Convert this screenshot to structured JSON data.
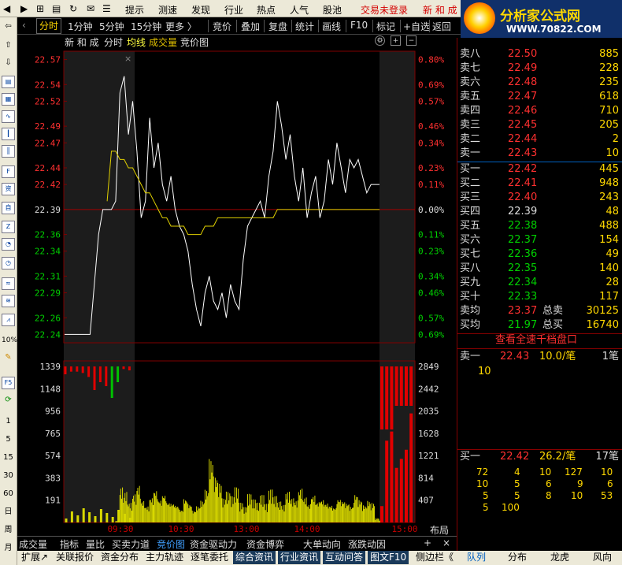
{
  "menu": {
    "items": [
      "提示",
      "测速",
      "发现",
      "行业",
      "热点",
      "人气",
      "股池"
    ],
    "status": "交易未登录",
    "stock": "新 和 成"
  },
  "logo": {
    "title": "分析家公式网",
    "url": "WWW.70822.COM"
  },
  "tabs": {
    "left": [
      "分时",
      "1分钟",
      "5分钟",
      "15分钟",
      "更多 〉"
    ],
    "right": [
      "竞价",
      "叠加",
      "复盘",
      "统计",
      "画线",
      "F10",
      "标记",
      "+自选",
      "返回"
    ]
  },
  "chart_header": {
    "name": "新 和 成",
    "mode": "分时",
    "avg": "均线",
    "vol": "成交量",
    "bid": "竞价图"
  },
  "leftbar": [
    "1",
    "5",
    "15",
    "30",
    "60",
    "日",
    "周",
    "月"
  ],
  "chart_data": {
    "type": "line",
    "title": "新和成 分时",
    "prev_close": 22.39,
    "price_ticks": [
      "22.57",
      "22.54",
      "22.52",
      "22.49",
      "22.47",
      "22.44",
      "22.42",
      "22.39",
      "22.36",
      "22.34",
      "22.31",
      "22.29",
      "22.26",
      "22.24"
    ],
    "pct_ticks": [
      "0.80%",
      "0.69%",
      "0.57%",
      "0.46%",
      "0.34%",
      "0.23%",
      "0.11%",
      "0.00%",
      "0.11%",
      "0.23%",
      "0.34%",
      "0.46%",
      "0.57%",
      "0.69%"
    ],
    "vol_ticks": [
      "1339",
      "1148",
      "956",
      "765",
      "574",
      "383",
      "191"
    ],
    "vol_right_ticks": [
      "2849",
      "2442",
      "2035",
      "1628",
      "1221",
      "814",
      "407"
    ],
    "time_ticks": [
      "09:30",
      "10:30",
      "13:00",
      "14:00",
      "15:00"
    ],
    "price": [
      22.24,
      22.24,
      22.24,
      22.24,
      22.24,
      22.24,
      22.24,
      22.3,
      22.36,
      22.39,
      22.39,
      22.39,
      22.4,
      22.53,
      22.55,
      22.48,
      22.52,
      22.46,
      22.38,
      22.4,
      22.5,
      22.44,
      22.47,
      22.42,
      22.4,
      22.43,
      22.39,
      22.37,
      22.36,
      22.34,
      22.3,
      22.27,
      22.25,
      22.29,
      22.31,
      22.28,
      22.27,
      22.29,
      22.26,
      22.3,
      22.28,
      22.27,
      22.33,
      22.37,
      22.38,
      22.39,
      22.4,
      22.38,
      22.43,
      22.46,
      22.52,
      22.49,
      22.45,
      22.48,
      22.43,
      22.4,
      22.44,
      22.38,
      22.41,
      22.43,
      22.38,
      22.4,
      22.45,
      22.42,
      22.47,
      22.44,
      22.41,
      22.45,
      22.44,
      22.45,
      22.43,
      22.41,
      22.42,
      22.42,
      22.42
    ],
    "avg": [
      22.39,
      22.39,
      22.39,
      22.39,
      22.39,
      22.39,
      22.39,
      22.39,
      22.39,
      22.39,
      22.4,
      22.46,
      22.46,
      22.45,
      22.45,
      22.44,
      22.44,
      22.43,
      22.42,
      22.41,
      22.41,
      22.4,
      22.39,
      22.38,
      22.38,
      22.37,
      22.37,
      22.37,
      22.37,
      22.36,
      22.36,
      22.36,
      22.36,
      22.37,
      22.37,
      22.37,
      22.38,
      22.38,
      22.38,
      22.38,
      22.38,
      22.38,
      22.38,
      22.38,
      22.38,
      22.38,
      22.38,
      22.38,
      22.38,
      22.38,
      22.39,
      22.39,
      22.39,
      22.39,
      22.39,
      22.39,
      22.39,
      22.39,
      22.39,
      22.39,
      22.39,
      22.39,
      22.39,
      22.39,
      22.39,
      22.39,
      22.39,
      22.39,
      22.39,
      22.39,
      22.39,
      22.39,
      22.39,
      22.39,
      22.39
    ],
    "volume": [
      0,
      0,
      0,
      0,
      0,
      0,
      0,
      0,
      0,
      0,
      0,
      0,
      15,
      320,
      280,
      180,
      260,
      340,
      200,
      150,
      230,
      300,
      210,
      260,
      190,
      180,
      160,
      120,
      220,
      170,
      110,
      150,
      200,
      300,
      580,
      420,
      360,
      220,
      280,
      240,
      320,
      180,
      140,
      260,
      210,
      180,
      250,
      170,
      300,
      240,
      190,
      160,
      280,
      220,
      200,
      310,
      230,
      170,
      250,
      190,
      210,
      180,
      160,
      140,
      220,
      200,
      180,
      150,
      260,
      210,
      160,
      200,
      180,
      40,
      20
    ],
    "bid_vol_top": [
      60,
      40,
      40,
      50,
      80,
      180,
      120,
      150,
      240,
      120,
      20,
      30
    ],
    "close_vol": [
      180,
      900,
      1000,
      600,
      700,
      800,
      1200
    ]
  },
  "orderbook": {
    "sell": [
      [
        "卖八",
        "22.50",
        "885"
      ],
      [
        "卖七",
        "22.49",
        "228"
      ],
      [
        "卖六",
        "22.48",
        "235"
      ],
      [
        "卖五",
        "22.47",
        "618"
      ],
      [
        "卖四",
        "22.46",
        "710"
      ],
      [
        "卖三",
        "22.45",
        "205"
      ],
      [
        "卖二",
        "22.44",
        "2"
      ],
      [
        "卖一",
        "22.43",
        "10"
      ]
    ],
    "buy": [
      [
        "买一",
        "22.42",
        "445"
      ],
      [
        "买二",
        "22.41",
        "948"
      ],
      [
        "买三",
        "22.40",
        "243"
      ],
      [
        "买四",
        "22.39",
        "48"
      ],
      [
        "买五",
        "22.38",
        "488"
      ],
      [
        "买六",
        "22.37",
        "154"
      ],
      [
        "买七",
        "22.36",
        "49"
      ],
      [
        "买八",
        "22.35",
        "140"
      ],
      [
        "买九",
        "22.34",
        "28"
      ],
      [
        "买十",
        "22.33",
        "117"
      ]
    ],
    "sell_avg": {
      "label": "卖均",
      "price": "23.37",
      "tlabel": "总卖",
      "total": "30125"
    },
    "buy_avg": {
      "label": "买均",
      "price": "21.97",
      "tlabel": "总买",
      "total": "16740"
    },
    "link": "查看全速千档盘口",
    "sell1": {
      "label": "卖一",
      "price": "22.43",
      "amt": "10.0/笔",
      "count": "1笔",
      "detail": "10"
    },
    "buy1": {
      "label": "买一",
      "price": "22.42",
      "amt": "26.2/笔",
      "count": "17笔"
    },
    "buy_detail": [
      [
        "72",
        "4",
        "10",
        "127",
        "10"
      ],
      [
        "10",
        "5",
        "6",
        "9",
        "6"
      ],
      [
        "5",
        "5",
        "8",
        "10",
        "53"
      ],
      [
        "5",
        "100"
      ]
    ]
  },
  "bottom_tabs1": [
    "成交量",
    "指标",
    "量比",
    "买卖力道",
    "竞价图",
    "资金驱动力",
    "资金博弈",
    "大单动向",
    "涨跌动因"
  ],
  "bottom_tabs2": [
    "扩展↗",
    "关联报价",
    "资金分布",
    "主力轨迹",
    "逐笔委托",
    "综合资讯",
    "行业资讯",
    "互动问答",
    "图文F10",
    "侧边栏《"
  ],
  "right_tabs": [
    "队列",
    "分布",
    "龙虎",
    "风向"
  ],
  "layout_btn": "布局"
}
